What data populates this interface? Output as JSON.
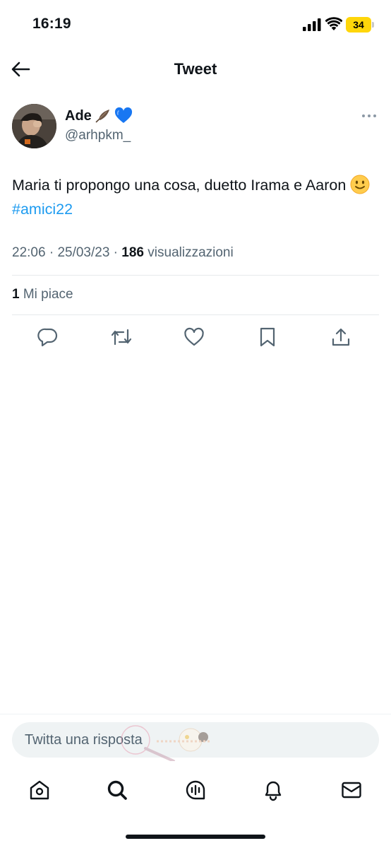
{
  "status_bar": {
    "time": "16:19",
    "battery": "34"
  },
  "header": {
    "title": "Tweet"
  },
  "tweet": {
    "display_name": "Ade",
    "handle": "@arhpkm_",
    "text_part1": "Maria ti propongo una cosa, duetto Irama e Aaron ",
    "hashtag": "#amici22",
    "time": "22:06",
    "date": "25/03/23",
    "views_count": "186",
    "views_label": "visualizzazioni",
    "likes_count": "1",
    "likes_label": "Mi piace"
  },
  "actions": [
    "reply-icon",
    "retweet-icon",
    "like-icon",
    "bookmark-icon",
    "share-icon"
  ],
  "reply": {
    "placeholder": "Twitta una risposta"
  },
  "tabbar": [
    "home-icon",
    "search-icon",
    "spaces-icon",
    "notifications-icon",
    "messages-icon"
  ],
  "colors": {
    "accent": "#1d9bf0",
    "text": "#0f1419",
    "secondary": "#536471",
    "battery": "#ffd60a"
  }
}
